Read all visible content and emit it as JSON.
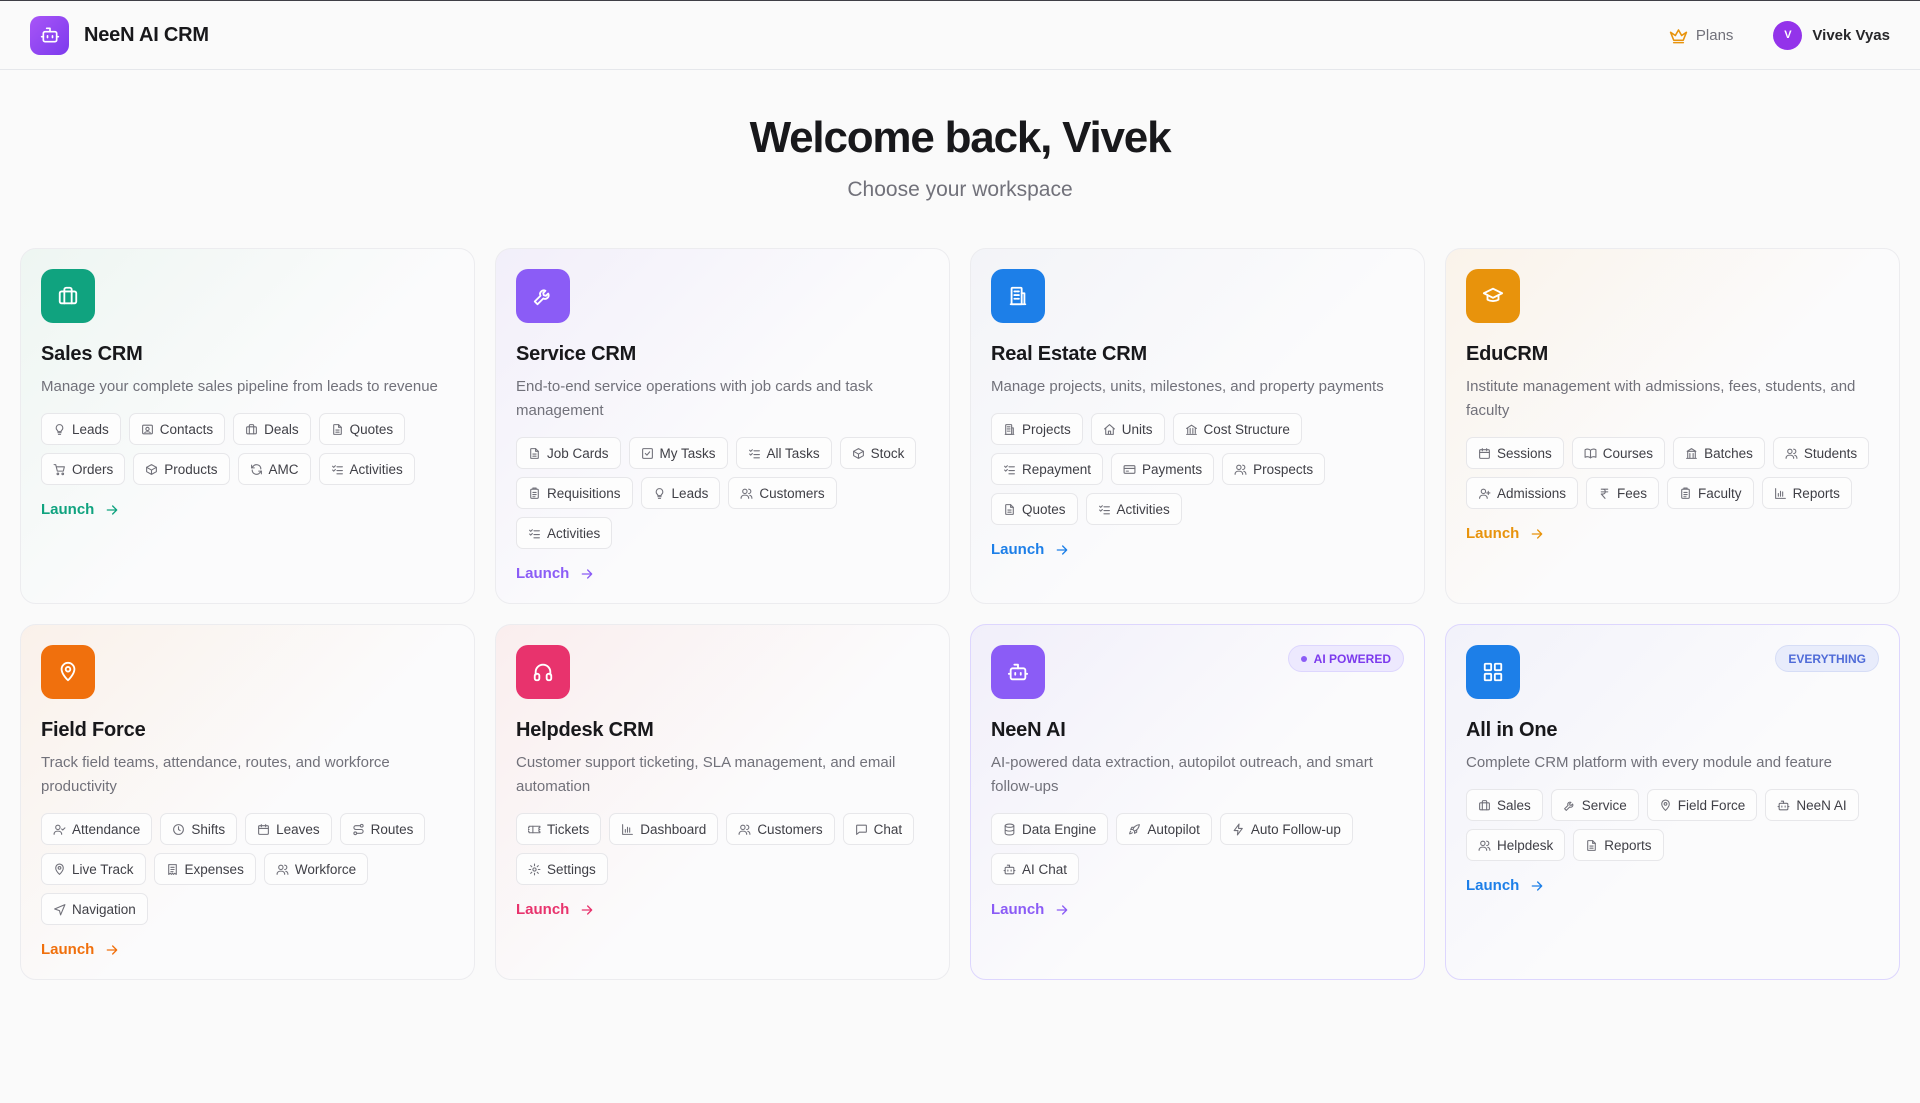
{
  "app": {
    "name": "NeeN AI CRM"
  },
  "header": {
    "plans_label": "Plans",
    "user_initial": "V",
    "user_name": "Vivek Vyas"
  },
  "hero": {
    "title": "Welcome back, Vivek",
    "subtitle": "Choose your workspace"
  },
  "cards": [
    {
      "title": "Sales CRM",
      "description": "Manage your complete sales pipeline from leads to revenue",
      "icon": "briefcase-icon",
      "color": "#10a37f",
      "tint": "#eef6f2",
      "launch_label": "Launch",
      "chips": [
        {
          "label": "Leads",
          "icon": "lightbulb-icon"
        },
        {
          "label": "Contacts",
          "icon": "contact-card-icon"
        },
        {
          "label": "Deals",
          "icon": "briefcase-icon"
        },
        {
          "label": "Quotes",
          "icon": "file-icon"
        },
        {
          "label": "Orders",
          "icon": "cart-icon"
        },
        {
          "label": "Products",
          "icon": "box-icon"
        },
        {
          "label": "AMC",
          "icon": "refresh-icon"
        },
        {
          "label": "Activities",
          "icon": "list-check-icon"
        }
      ]
    },
    {
      "title": "Service CRM",
      "description": "End-to-end service operations with job cards and task management",
      "icon": "wrench-icon",
      "color": "#8b5cf6",
      "tint": "#f2effa",
      "launch_label": "Launch",
      "chips": [
        {
          "label": "Job Cards",
          "icon": "file-icon"
        },
        {
          "label": "My Tasks",
          "icon": "check-square-icon"
        },
        {
          "label": "All Tasks",
          "icon": "list-check-icon"
        },
        {
          "label": "Stock",
          "icon": "box-icon"
        },
        {
          "label": "Requisitions",
          "icon": "clipboard-icon"
        },
        {
          "label": "Leads",
          "icon": "lightbulb-icon"
        },
        {
          "label": "Customers",
          "icon": "users-icon"
        },
        {
          "label": "Activities",
          "icon": "list-check-icon"
        }
      ]
    },
    {
      "title": "Real Estate CRM",
      "description": "Manage projects, units, milestones, and property payments",
      "icon": "building-icon",
      "color": "#1d7fe8",
      "tint": "#f3f4f8",
      "launch_label": "Launch",
      "chips": [
        {
          "label": "Projects",
          "icon": "building-icon"
        },
        {
          "label": "Units",
          "icon": "home-icon"
        },
        {
          "label": "Cost Structure",
          "icon": "landmark-icon"
        },
        {
          "label": "Repayment",
          "icon": "list-check-icon"
        },
        {
          "label": "Payments",
          "icon": "credit-card-icon"
        },
        {
          "label": "Prospects",
          "icon": "users-icon"
        },
        {
          "label": "Quotes",
          "icon": "file-icon"
        },
        {
          "label": "Activities",
          "icon": "list-check-icon"
        }
      ]
    },
    {
      "title": "EduCRM",
      "description": "Institute management with admissions, fees, students, and faculty",
      "icon": "graduation-cap-icon",
      "color": "#e8930c",
      "tint": "#faf3ea",
      "launch_label": "Launch",
      "chips": [
        {
          "label": "Sessions",
          "icon": "calendar-icon"
        },
        {
          "label": "Courses",
          "icon": "book-icon"
        },
        {
          "label": "Batches",
          "icon": "school-icon"
        },
        {
          "label": "Students",
          "icon": "users-icon"
        },
        {
          "label": "Admissions",
          "icon": "user-plus-icon"
        },
        {
          "label": "Fees",
          "icon": "rupee-icon"
        },
        {
          "label": "Faculty",
          "icon": "clipboard-icon"
        },
        {
          "label": "Reports",
          "icon": "bar-chart-icon"
        }
      ]
    },
    {
      "title": "Field Force",
      "description": "Track field teams, attendance, routes, and workforce productivity",
      "icon": "map-pin-icon",
      "color": "#f0700d",
      "tint": "#faf1ea",
      "launch_label": "Launch",
      "chips": [
        {
          "label": "Attendance",
          "icon": "user-check-icon"
        },
        {
          "label": "Shifts",
          "icon": "clock-icon"
        },
        {
          "label": "Leaves",
          "icon": "calendar-icon"
        },
        {
          "label": "Routes",
          "icon": "route-icon"
        },
        {
          "label": "Live Track",
          "icon": "map-pin-icon"
        },
        {
          "label": "Expenses",
          "icon": "receipt-icon"
        },
        {
          "label": "Workforce",
          "icon": "users-icon"
        },
        {
          "label": "Navigation",
          "icon": "navigation-icon"
        }
      ]
    },
    {
      "title": "Helpdesk CRM",
      "description": "Customer support ticketing, SLA management, and email automation",
      "icon": "headphones-icon",
      "color": "#e8336d",
      "tint": "#faeeee",
      "launch_label": "Launch",
      "chips": [
        {
          "label": "Tickets",
          "icon": "ticket-icon"
        },
        {
          "label": "Dashboard",
          "icon": "bar-chart-icon"
        },
        {
          "label": "Customers",
          "icon": "users-icon"
        },
        {
          "label": "Chat",
          "icon": "message-icon"
        },
        {
          "label": "Settings",
          "icon": "gear-icon"
        }
      ]
    },
    {
      "title": "NeeN AI",
      "description": "AI-powered data extraction, autopilot outreach, and smart follow-ups",
      "icon": "bot-icon",
      "color": "#8b5cf6",
      "tint": "#f1effa",
      "launch_label": "Launch",
      "badge": "AI POWERED",
      "chips": [
        {
          "label": "Data Engine",
          "icon": "database-icon"
        },
        {
          "label": "Autopilot",
          "icon": "rocket-icon"
        },
        {
          "label": "Auto Follow-up",
          "icon": "zap-icon"
        },
        {
          "label": "AI Chat",
          "icon": "bot-icon"
        }
      ]
    },
    {
      "title": "All in One",
      "description": "Complete CRM platform with every module and feature",
      "icon": "grid-icon",
      "color": "#1d7fe8",
      "tint": "#f2f2fa",
      "launch_label": "Launch",
      "badge": "EVERYTHING",
      "chips": [
        {
          "label": "Sales",
          "icon": "briefcase-icon"
        },
        {
          "label": "Service",
          "icon": "wrench-icon"
        },
        {
          "label": "Field Force",
          "icon": "map-pin-icon"
        },
        {
          "label": "NeeN AI",
          "icon": "bot-icon"
        },
        {
          "label": "Helpdesk",
          "icon": "users-icon"
        },
        {
          "label": "Reports",
          "icon": "file-icon"
        }
      ]
    }
  ]
}
